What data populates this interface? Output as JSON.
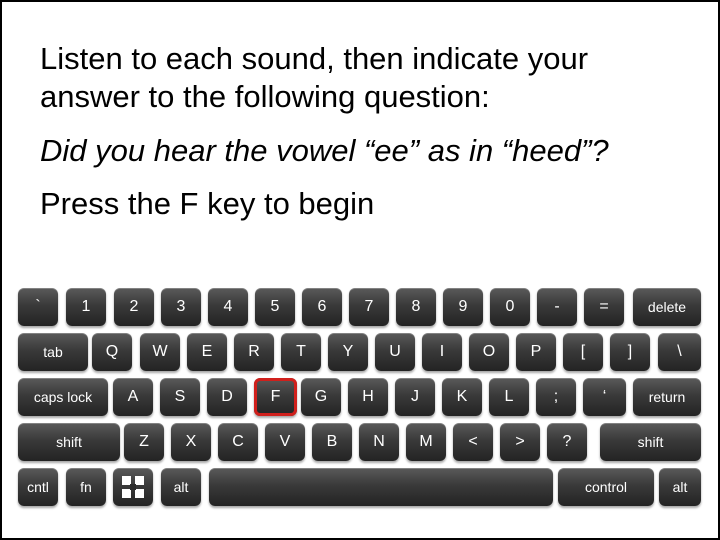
{
  "instructions": {
    "line1": "Listen to each sound, then indicate your",
    "line2": "answer to the following question:",
    "question": "Did you hear the vowel “ee” as in “heed”?",
    "prompt": "Press the F key to begin"
  },
  "keyboard": {
    "highlight_color": "#d0201c",
    "rows": [
      [
        "`",
        "1",
        "2",
        "3",
        "4",
        "5",
        "6",
        "7",
        "8",
        "9",
        "0",
        "-",
        "=",
        "delete"
      ],
      [
        "tab",
        "Q",
        "W",
        "E",
        "R",
        "T",
        "Y",
        "U",
        "I",
        "O",
        "P",
        "[",
        "]",
        "\\"
      ],
      [
        "caps lock",
        "A",
        "S",
        "D",
        "F",
        "G",
        "H",
        "J",
        "K",
        "L",
        ";",
        "‘",
        "return"
      ],
      [
        "shift",
        "Z",
        "X",
        "C",
        "V",
        "B",
        "N",
        "M",
        "<",
        ">",
        "?",
        "shift"
      ],
      [
        "cntl",
        "fn",
        "command-grid-icon",
        "alt",
        "",
        "control",
        "alt"
      ]
    ],
    "highlighted_key": "F"
  }
}
